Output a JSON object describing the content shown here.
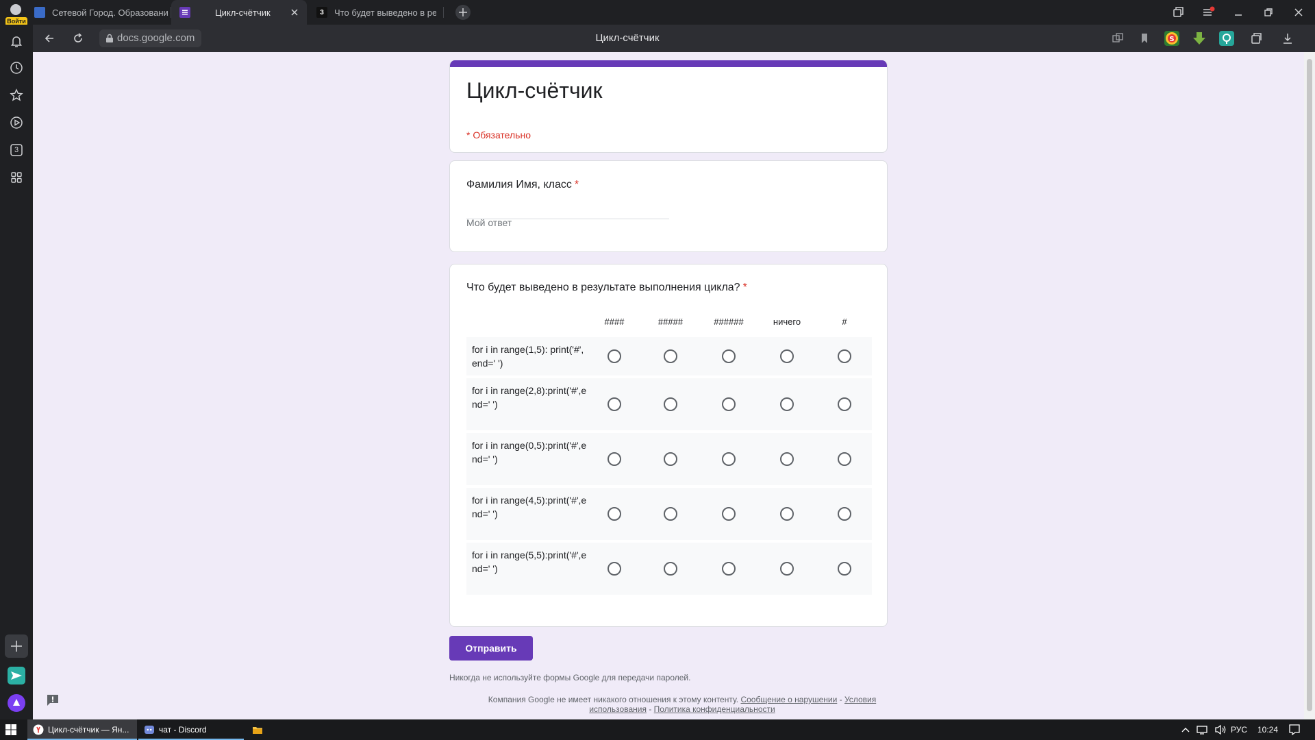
{
  "browser": {
    "avatar_label": "Войти",
    "tabs": [
      {
        "title": "Сетевой Город. Образование",
        "favicon_color": "#3a6bc7"
      },
      {
        "title": "Цикл-счётчик",
        "favicon_color": "#673ab7"
      },
      {
        "title": "Что будет выведено в результате",
        "favicon_color": "#111111",
        "favicon_text": "3"
      }
    ],
    "url": "docs.google.com",
    "page_title": "Цикл-счётчик",
    "icons": [
      "back-icon",
      "reload-icon",
      "lock-icon",
      "bookmark-icon",
      "download-icon",
      "minimize-icon",
      "maximize-icon",
      "close-icon"
    ]
  },
  "sidebar": {
    "badge_number": "3"
  },
  "form": {
    "title": "Цикл-счётчик",
    "required_note": "* Обязательно",
    "q1": {
      "title": "Фамилия Имя, класс",
      "star": "*",
      "placeholder": "Мой ответ"
    },
    "q2": {
      "title": "Что будет выведено в результате выполнения цикла?",
      "star": "*",
      "columns": [
        "####",
        "#####",
        "######",
        "ничего",
        "#"
      ],
      "rows": [
        "for i in range(1,5): print('#',end=' ')",
        "for i in range(2,8):print('#',end=' ')",
        "for i in range(0,5):print('#',end=' ')",
        "for i in range(4,5):print('#',end=' ')",
        "for i in range(5,5):print('#',end=' ')"
      ]
    },
    "submit_label": "Отправить",
    "footer_note": "Никогда не используйте формы Google для передачи паролей.",
    "footer": {
      "text": "Компания Google не имеет никакого отношения к этому контенту.",
      "report_link": "Сообщение о нарушении",
      "sep1": "-",
      "terms_link": "Условия использования",
      "sep2": "-",
      "privacy_link": "Политика конфиденциальности"
    }
  },
  "taskbar": {
    "items": [
      "Цикл-счётчик — Ян...",
      "чат - Discord"
    ],
    "lang": "РУС",
    "time": "10:24"
  },
  "colors": {
    "accent": "#673ab7",
    "required": "#d93025",
    "page_bg": "#f0ebf8"
  }
}
